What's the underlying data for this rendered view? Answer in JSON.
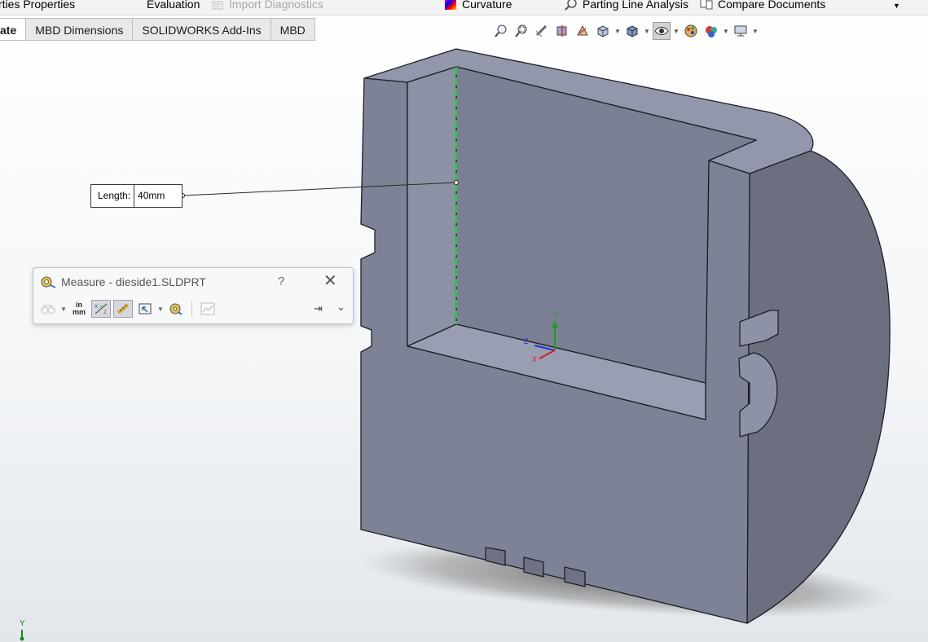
{
  "ribbon_top": {
    "partial_left": "rties  Properties",
    "partial_eval": "Evaluation",
    "import_diagnostics": "Import Diagnostics",
    "curvature": "Curvature",
    "parting_line_analysis": "Parting Line Analysis",
    "compare_documents": "Compare Documents"
  },
  "tabs": [
    {
      "label": "ate",
      "active": true
    },
    {
      "label": "MBD Dimensions",
      "active": false
    },
    {
      "label": "SOLIDWORKS Add-Ins",
      "active": false
    },
    {
      "label": "MBD",
      "active": false
    }
  ],
  "callout": {
    "label": "Length:",
    "value": "40mm"
  },
  "measure_dialog": {
    "title": "Measure - dieside1.SLDPRT",
    "help": "?",
    "units_top": "in",
    "units_bottom": "mm"
  },
  "triad": {
    "y": "Y",
    "z": "Z",
    "x": "X"
  },
  "colors": {
    "face_front": "#7e8296",
    "face_top": "#9397ab",
    "face_side": "#6b6f80",
    "face_pocket_back": "#7b7f93",
    "face_pocket_floor": "#9a9eb2",
    "highlight_edge": "#22c93a"
  }
}
